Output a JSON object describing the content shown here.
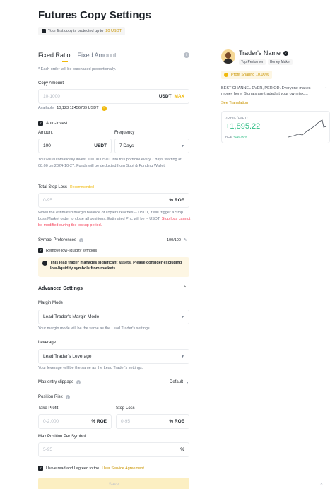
{
  "page": {
    "title": "Futures Copy Settings",
    "protect_text": "Your first copy is protected up to",
    "protect_amount": "20 USDT"
  },
  "tabs": [
    {
      "label": "Fixed Ratio"
    },
    {
      "label": "Fixed Amount"
    }
  ],
  "note_proportional": "* Each order will be purchased proportionally.",
  "copy_amount": {
    "label": "Copy Amount",
    "placeholder": "10-1000",
    "unit": "USDT",
    "max": "MAX",
    "available_label": "Available",
    "available_value": "10,123.12456789 USDT"
  },
  "auto_invest": {
    "label": "Auto-Invest",
    "amount_label": "Amount",
    "amount_value": "100",
    "amount_unit": "USDT",
    "frequency_label": "Frequency",
    "frequency_value": "7 Days",
    "note": "You will automatically invest 100.00 USDT into this portfolio every 7 days starting at 08:00 on 2024-10-27. Funds will be deducted from Spot & Funding Wallet."
  },
  "stop_loss": {
    "label": "Total Stop Loss",
    "recommended": "Recommended",
    "placeholder": "0-95",
    "unit": "% ROE",
    "note_1": "When the estimated margin balance of copiers reaches -- USDT, it will trigger a Stop Loss Market order to close all positions. Estimated PnL will be -- USDT.",
    "note_red": "Stop loss cannot be modified during the lockup period."
  },
  "symbol_prefs": {
    "label": "Symbol Preferences",
    "count": "100/100",
    "remove_label": "Remove low-liquidity symbols",
    "warning": "This lead trader manages significant assets. Please consider excluding low-liquidity symbols from markets."
  },
  "advanced": {
    "label": "Advanced Settings",
    "margin_mode_label": "Margin Mode",
    "margin_mode_value": "Lead Trader's Margin Mode",
    "margin_mode_note": "Your margin mode will be the same as the Lead Trader's settings.",
    "leverage_label": "Leverage",
    "leverage_value": "Lead Trader's Leverage",
    "leverage_note": "Your leverage will be the same as the Lead Trader's settings.",
    "slippage_label": "Max entry slippage",
    "slippage_value": "Default",
    "position_risk_label": "Position Risk",
    "take_profit_label": "Take Profit",
    "take_profit_placeholder": "0-2,000",
    "stop_loss_label": "Stop Loss",
    "stop_loss_placeholder": "0-95",
    "roe_unit": "% ROE",
    "max_pos_label": "Max Position Per Symbol",
    "max_pos_placeholder": "5-95",
    "pct_unit": "%"
  },
  "agreement": {
    "text": "I have read and I agreed to the",
    "link": "User Service Agreement."
  },
  "save_label": "Save",
  "trader": {
    "name": "Trader's Name",
    "badge_1": "Top Performer",
    "badge_2": "Honey Maker",
    "profit_sharing": "Profit Sharing 10.00%",
    "description": "BEST CHANNEL EVER, PERIOD. Everyone makes money here! Signals are traded at your own risk....",
    "see_translation": "See Translation",
    "pnl_label": "7D PnL (USDT)",
    "pnl_value": "+1,895.22",
    "roe_label": "ROE",
    "roe_value": "+116.00%"
  },
  "colors": {
    "accent": "#f0b90b",
    "green": "#2ebd85",
    "red": "#f6465d"
  }
}
